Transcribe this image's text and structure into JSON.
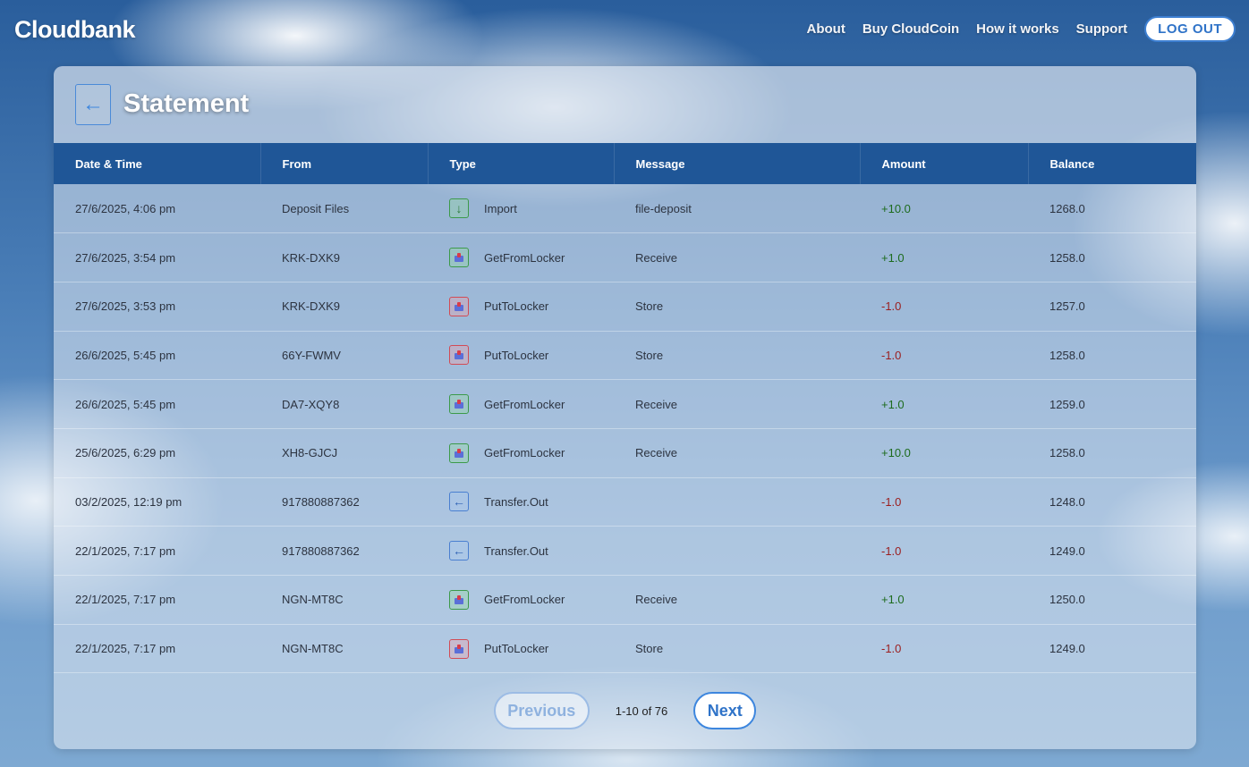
{
  "brand": {
    "name": "Cloudbank"
  },
  "nav": {
    "links": [
      "About",
      "Buy CloudCoin",
      "How it works",
      "Support"
    ],
    "logout_label": "LOG OUT"
  },
  "page": {
    "title": "Statement",
    "back_icon": "arrow-left-icon"
  },
  "table": {
    "headers": [
      "Date & Time",
      "From",
      "Type",
      "Message",
      "Amount",
      "Balance"
    ],
    "rows": [
      {
        "date": "27/6/2025, 4:06 pm",
        "from": "Deposit Files",
        "type": "Import",
        "icon": "import",
        "message": "file-deposit",
        "amount": "+10.0",
        "balance": "1268.0"
      },
      {
        "date": "27/6/2025, 3:54 pm",
        "from": "KRK-DXK9",
        "type": "GetFromLocker",
        "icon": "get",
        "message": "Receive",
        "amount": "+1.0",
        "balance": "1258.0"
      },
      {
        "date": "27/6/2025, 3:53 pm",
        "from": "KRK-DXK9",
        "type": "PutToLocker",
        "icon": "put",
        "message": "Store",
        "amount": "-1.0",
        "balance": "1257.0"
      },
      {
        "date": "26/6/2025, 5:45 pm",
        "from": "66Y-FWMV",
        "type": "PutToLocker",
        "icon": "put",
        "message": "Store",
        "amount": "-1.0",
        "balance": "1258.0"
      },
      {
        "date": "26/6/2025, 5:45 pm",
        "from": "DA7-XQY8",
        "type": "GetFromLocker",
        "icon": "get",
        "message": "Receive",
        "amount": "+1.0",
        "balance": "1259.0"
      },
      {
        "date": "25/6/2025, 6:29 pm",
        "from": "XH8-GJCJ",
        "type": "GetFromLocker",
        "icon": "get",
        "message": "Receive",
        "amount": "+10.0",
        "balance": "1258.0"
      },
      {
        "date": "03/2/2025, 12:19 pm",
        "from": "917880887362",
        "type": "Transfer.Out",
        "icon": "transfer",
        "message": "",
        "amount": "-1.0",
        "balance": "1248.0"
      },
      {
        "date": "22/1/2025, 7:17 pm",
        "from": "917880887362",
        "type": "Transfer.Out",
        "icon": "transfer",
        "message": "",
        "amount": "-1.0",
        "balance": "1249.0"
      },
      {
        "date": "22/1/2025, 7:17 pm",
        "from": "NGN-MT8C",
        "type": "GetFromLocker",
        "icon": "get",
        "message": "Receive",
        "amount": "+1.0",
        "balance": "1250.0"
      },
      {
        "date": "22/1/2025, 7:17 pm",
        "from": "NGN-MT8C",
        "type": "PutToLocker",
        "icon": "put",
        "message": "Store",
        "amount": "-1.0",
        "balance": "1249.0"
      }
    ]
  },
  "pagination": {
    "previous_label": "Previous",
    "next_label": "Next",
    "info": "1-10 of 76"
  },
  "colors": {
    "header_bg": "#1f5697",
    "positive": "#1d6b1d",
    "negative": "#9b1d1d",
    "accent": "#3d86de"
  }
}
